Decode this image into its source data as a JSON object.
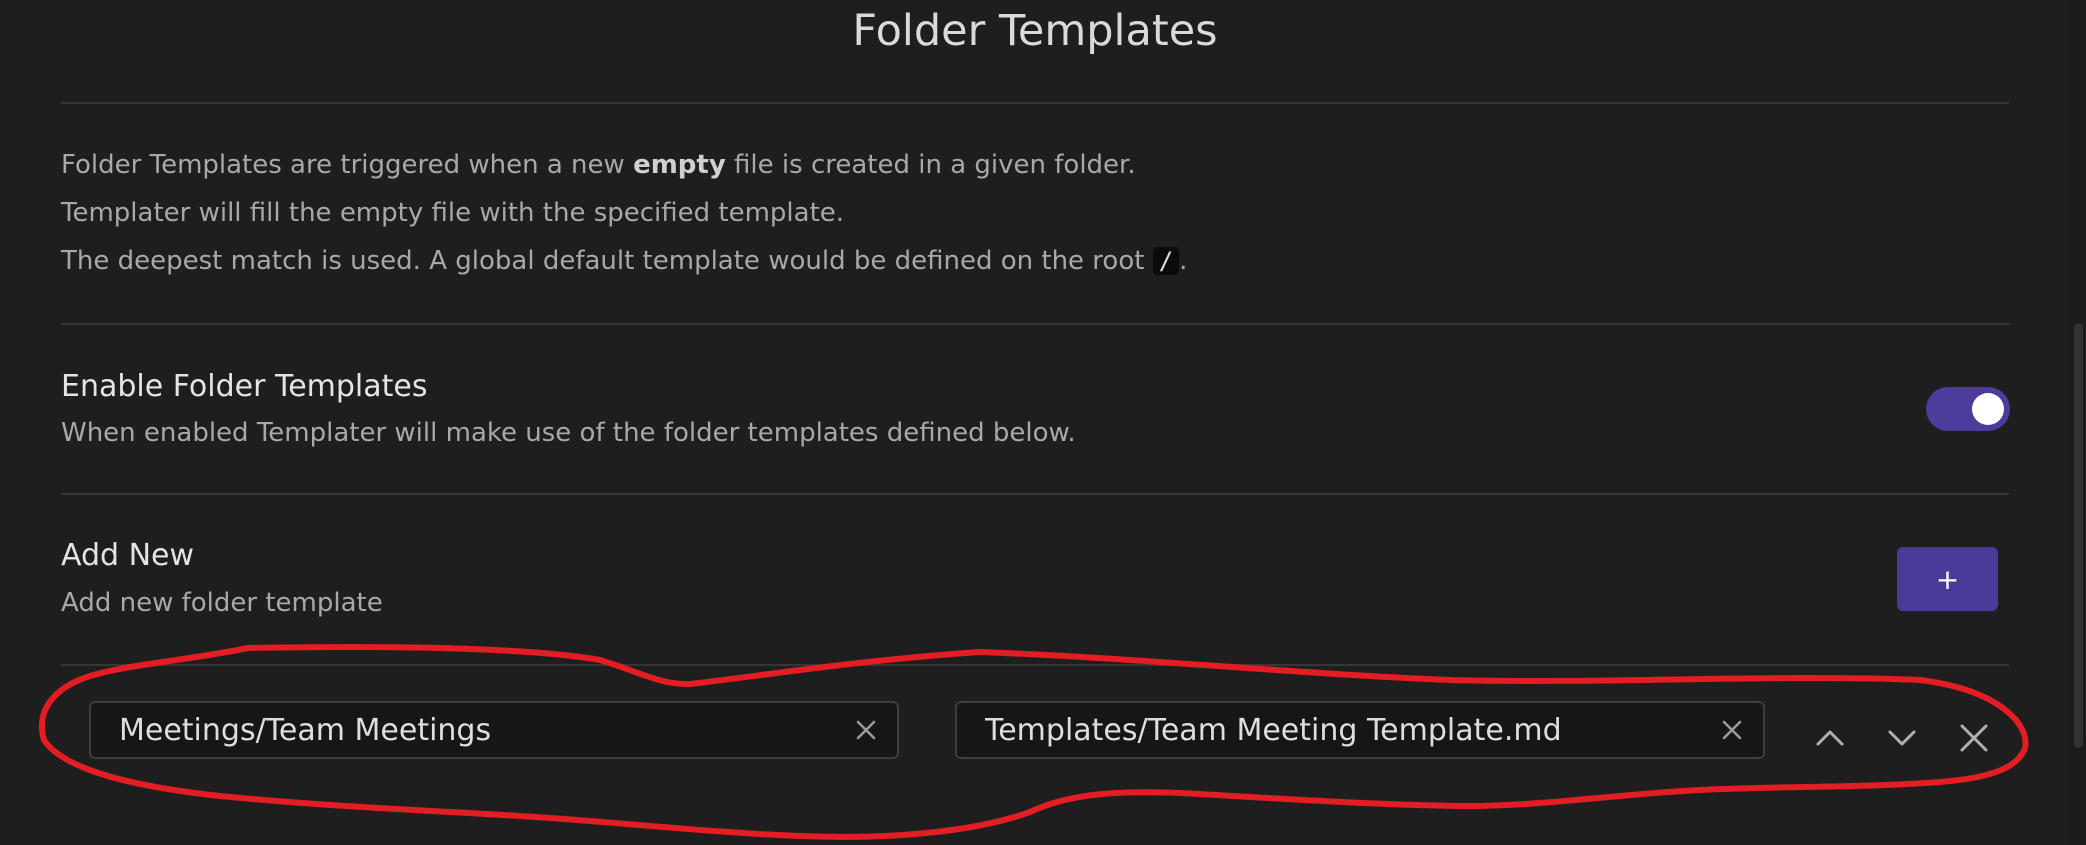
{
  "page": {
    "title": "Folder Templates"
  },
  "description": {
    "line1_before": "Folder Templates are triggered when a new ",
    "line1_bold": "empty",
    "line1_after": " file is created in a given folder.",
    "line2": "Templater will fill the empty file with the specified template.",
    "line3_before": "The deepest match is used. A global default template would be defined on the root ",
    "line3_code": "/",
    "line3_after": "."
  },
  "settings": {
    "enable": {
      "name": "Enable Folder Templates",
      "description": "When enabled Templater will make use of the folder templates defined below.",
      "enabled": true
    },
    "add_new": {
      "name": "Add New",
      "description": "Add new folder template",
      "button_label": "+"
    }
  },
  "folder_template_row": {
    "folder_value": "Meetings/Team Meetings",
    "template_value": "Templates/Team Meeting Template.md",
    "icons": [
      "chevron-up-icon",
      "chevron-down-icon",
      "close-icon"
    ]
  },
  "colors": {
    "background": "#1e1e1e",
    "accent": "#4a3a9a",
    "annotation": "#e21d24"
  }
}
